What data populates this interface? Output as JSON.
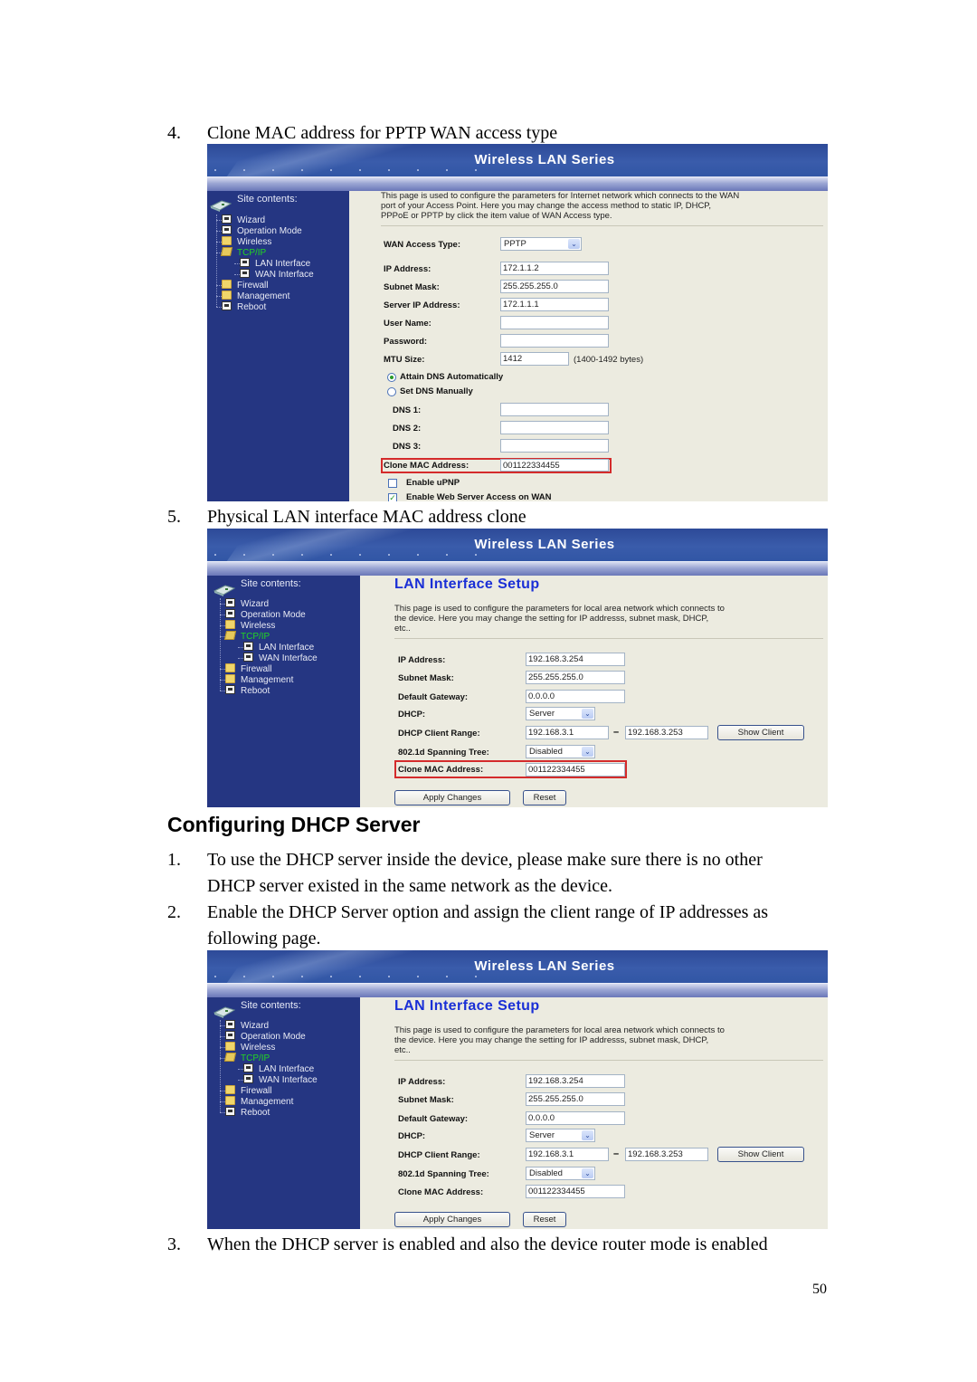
{
  "document": {
    "step4": {
      "num": "4.",
      "text": "Clone MAC address for PPTP WAN access type"
    },
    "step5": {
      "num": "5.",
      "text": "Physical LAN interface MAC address clone"
    },
    "section_heading": "Configuring DHCP Server",
    "dhcp_steps": [
      {
        "num": "1.",
        "line1": "To use the DHCP server inside the device, please make sure there is no other",
        "line2": "DHCP server existed in the same network as the device."
      },
      {
        "num": "2.",
        "line1": "Enable the DHCP Server option and assign the client range of IP addresses as",
        "line2": "following page."
      },
      {
        "num": "3.",
        "line1": "When the DHCP server is enabled and also the device router mode is enabled"
      }
    ],
    "page_number": "50"
  },
  "shared": {
    "banner_title": "Wireless LAN Series",
    "site_contents": "Site contents:",
    "nav": [
      {
        "label": "Wizard",
        "icon": "page-icon"
      },
      {
        "label": "Operation Mode",
        "icon": "page-icon"
      },
      {
        "label": "Wireless",
        "icon": "folder-icon"
      },
      {
        "label": "TCP/IP",
        "icon": "folder-open-icon",
        "active": true
      },
      {
        "label": "LAN Interface",
        "icon": "page-icon",
        "sub": true
      },
      {
        "label": "WAN Interface",
        "icon": "page-icon",
        "sub": true
      },
      {
        "label": "Firewall",
        "icon": "folder-icon"
      },
      {
        "label": "Management",
        "icon": "folder-icon"
      },
      {
        "label": "Reboot",
        "icon": "page-icon"
      }
    ],
    "colors": {
      "active_nav": "#22d622",
      "title_blue": "#1a2fd6",
      "highlight_red": "#d42b2b",
      "sidebar": "#253682"
    }
  },
  "wan_screen": {
    "intro": [
      "This page is used to configure the parameters for Internet network which connects to the WAN",
      "port of your Access Point. Here you may change the access method to static IP, DHCP,",
      "PPPoE or PPTP by click the item value of WAN Access type."
    ],
    "wan_access_type": {
      "label": "WAN Access Type:",
      "value": "PPTP"
    },
    "ip_address": {
      "label": "IP Address:",
      "value": "172.1.1.2"
    },
    "subnet_mask": {
      "label": "Subnet Mask:",
      "value": "255.255.255.0"
    },
    "server_ip": {
      "label": "Server IP Address:",
      "value": "172.1.1.1"
    },
    "user_name": {
      "label": "User Name:",
      "value": ""
    },
    "password": {
      "label": "Password:",
      "value": ""
    },
    "mtu": {
      "label": "MTU Size:",
      "value": "1412",
      "hint": "(1400-1492 bytes)"
    },
    "dns_auto": {
      "label": "Attain DNS Automatically",
      "checked": true
    },
    "dns_manual": {
      "label": "Set DNS Manually",
      "checked": false
    },
    "dns1": {
      "label": "DNS 1:",
      "value": ""
    },
    "dns2": {
      "label": "DNS 2:",
      "value": ""
    },
    "dns3": {
      "label": "DNS 3:",
      "value": ""
    },
    "clone_mac": {
      "label": "Clone MAC Address:",
      "value": "001122334455"
    },
    "upnp": {
      "label": "Enable uPNP",
      "checked": false
    },
    "web_access": {
      "label": "Enable Web Server Access on WAN",
      "checked": true
    }
  },
  "lan_screens": [
    {
      "title": "LAN Interface Setup",
      "intro": [
        "This page is used to configure the parameters for local area network which connects to",
        "the device. Here you may change the setting for IP addresss, subnet mask, DHCP,",
        "etc.."
      ],
      "ip_address": {
        "label": "IP Address:",
        "value": "192.168.3.254"
      },
      "subnet_mask": {
        "label": "Subnet Mask:",
        "value": "255.255.255.0"
      },
      "gateway": {
        "label": "Default Gateway:",
        "value": "0.0.0.0"
      },
      "dhcp": {
        "label": "DHCP:",
        "value": "Server"
      },
      "range": {
        "label": "DHCP Client Range:",
        "start": "192.168.3.1",
        "sep": "–",
        "end": "192.168.3.253",
        "button": "Show Client"
      },
      "stp": {
        "label": "802.1d Spanning Tree:",
        "value": "Disabled"
      },
      "clone_mac": {
        "label": "Clone MAC Address:",
        "value": "001122334455"
      },
      "apply": "Apply Changes",
      "reset": "Reset"
    },
    {
      "title": "LAN Interface Setup",
      "intro": [
        "This page is used to configure the parameters for local area network which connects to",
        "the device. Here you may change the setting for IP addresss, subnet mask, DHCP,",
        "etc.."
      ],
      "ip_address": {
        "label": "IP Address:",
        "value": "192.168.3.254"
      },
      "subnet_mask": {
        "label": "Subnet Mask:",
        "value": "255.255.255.0"
      },
      "gateway": {
        "label": "Default Gateway:",
        "value": "0.0.0.0"
      },
      "dhcp": {
        "label": "DHCP:",
        "value": "Server"
      },
      "range": {
        "label": "DHCP Client Range:",
        "start": "192.168.3.1",
        "sep": "–",
        "end": "192.168.3.253",
        "button": "Show Client"
      },
      "stp": {
        "label": "802.1d Spanning Tree:",
        "value": "Disabled"
      },
      "clone_mac": {
        "label": "Clone MAC Address:",
        "value": "001122334455"
      },
      "apply": "Apply Changes",
      "reset": "Reset"
    }
  ]
}
